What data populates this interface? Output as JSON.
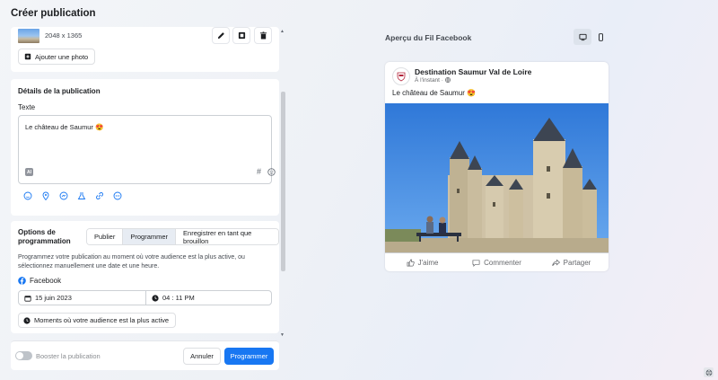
{
  "page": {
    "title": "Créer publication"
  },
  "media": {
    "dimensions": "2048 x 1365",
    "add_photo_label": "Ajouter une photo"
  },
  "details": {
    "title": "Détails de la publication",
    "text_label": "Texte",
    "text_value": "Le château de Saumur 😍"
  },
  "options": {
    "title": "Options de programmation",
    "tabs": [
      {
        "label": "Publier",
        "active": false
      },
      {
        "label": "Programmer",
        "active": true
      },
      {
        "label": "Enregistrer en tant que brouillon",
        "active": false
      }
    ],
    "description": "Programmez votre publication au moment où votre audience est la plus active, ou sélectionnez manuellement une date et une heure.",
    "network": "Facebook",
    "date": "15 juin 2023",
    "time": "04 : 11 PM",
    "best_time_label": "Moments où votre audience est la plus active"
  },
  "footer": {
    "boost_label": "Booster la publication",
    "cancel_label": "Annuler",
    "submit_label": "Programmer"
  },
  "preview": {
    "title": "Aperçu du Fil Facebook",
    "page_name": "Destination Saumur Val de Loire",
    "time": "À l'instant · ",
    "text": "Le château de Saumur 😍",
    "actions": {
      "like": "J'aime",
      "comment": "Commenter",
      "share": "Partager"
    }
  },
  "colors": {
    "primary": "#1877f2",
    "facebook": "#1877f2",
    "accent_icon": "#1877f2"
  }
}
